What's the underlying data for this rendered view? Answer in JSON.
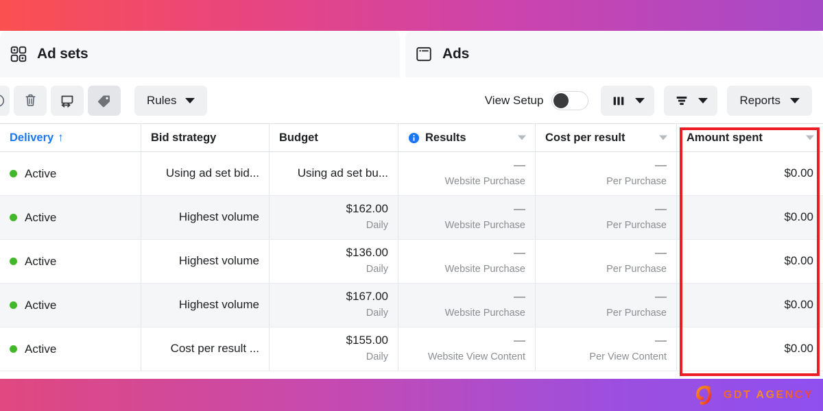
{
  "tabs": [
    {
      "label": "Ad sets",
      "icon": "grid-four-squares-icon",
      "active": false
    },
    {
      "label": "Ads",
      "icon": "ad-card-icon",
      "active": true
    }
  ],
  "toolbar": {
    "icon_buttons": [
      {
        "name": "edit-button",
        "icon": "pencil-icon"
      },
      {
        "name": "delete-button",
        "icon": "trash-icon"
      },
      {
        "name": "duplicate-button",
        "icon": "duplicate-arrow-icon"
      },
      {
        "name": "tag-button",
        "icon": "tag-icon"
      }
    ],
    "rules_label": "Rules",
    "view_setup_label": "View Setup",
    "view_setup_on": false,
    "columns_button_icon": "columns-icon",
    "breakdown_button_icon": "breakdown-icon",
    "reports_label": "Reports"
  },
  "table": {
    "columns": [
      {
        "key": "delivery",
        "label": "Delivery",
        "sorted": true,
        "sort_dir": "↑",
        "has_menu": false,
        "info": false
      },
      {
        "key": "bid",
        "label": "Bid strategy",
        "sorted": false,
        "has_menu": false,
        "info": false
      },
      {
        "key": "budget",
        "label": "Budget",
        "sorted": false,
        "has_menu": false,
        "info": false
      },
      {
        "key": "results",
        "label": "Results",
        "sorted": false,
        "has_menu": true,
        "info": true
      },
      {
        "key": "cpr",
        "label": "Cost per result",
        "sorted": false,
        "has_menu": true,
        "info": false
      },
      {
        "key": "spent",
        "label": "Amount spent",
        "sorted": false,
        "has_menu": true,
        "info": false
      }
    ],
    "rows": [
      {
        "delivery": "Active",
        "bid": "Using ad set bid...",
        "budget": "Using ad set bu...",
        "budget_sub": "",
        "results": "—",
        "results_sub": "Website Purchase",
        "cpr": "—",
        "cpr_sub": "Per Purchase",
        "spent": "$0.00"
      },
      {
        "delivery": "Active",
        "bid": "Highest volume",
        "budget": "$162.00",
        "budget_sub": "Daily",
        "results": "—",
        "results_sub": "Website Purchase",
        "cpr": "—",
        "cpr_sub": "Per Purchase",
        "spent": "$0.00"
      },
      {
        "delivery": "Active",
        "bid": "Highest volume",
        "budget": "$136.00",
        "budget_sub": "Daily",
        "results": "—",
        "results_sub": "Website Purchase",
        "cpr": "—",
        "cpr_sub": "Per Purchase",
        "spent": "$0.00"
      },
      {
        "delivery": "Active",
        "bid": "Highest volume",
        "budget": "$167.00",
        "budget_sub": "Daily",
        "results": "—",
        "results_sub": "Website Purchase",
        "cpr": "—",
        "cpr_sub": "Per Purchase",
        "spent": "$0.00"
      },
      {
        "delivery": "Active",
        "bid": "Cost per result ...",
        "budget": "$155.00",
        "budget_sub": "Daily",
        "results": "—",
        "results_sub": "Website View Content",
        "cpr": "—",
        "cpr_sub": "Per View Content",
        "spent": "$0.00"
      }
    ]
  },
  "annotation": {
    "highlight_color": "#ee1c25",
    "highlighted_column": "Amount spent"
  },
  "watermark": {
    "text": "GDT AGENCY",
    "logo": "gdt-monogram-icon"
  },
  "colors": {
    "accent_blue": "#1877f2",
    "status_green": "#42b72a",
    "gradient_top_start": "#fb5050",
    "gradient_top_end": "#a64ac9",
    "gradient_bottom_start": "#e0487f",
    "gradient_bottom_end": "#8f4ff0"
  }
}
